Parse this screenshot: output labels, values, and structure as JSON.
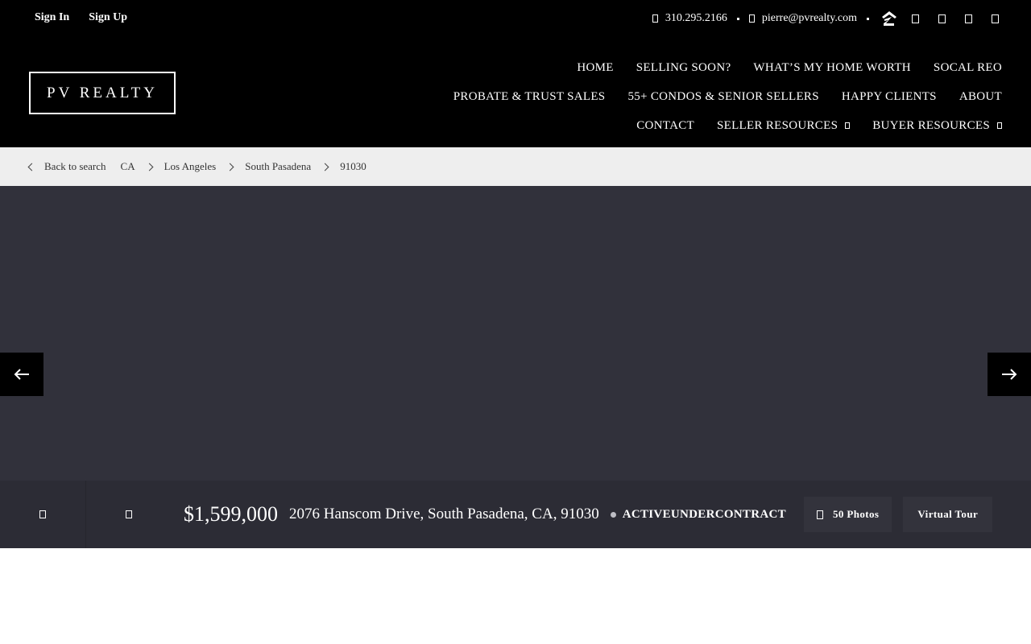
{
  "auth": {
    "sign_in": "Sign In",
    "sign_up": "Sign Up"
  },
  "contact": {
    "phone": "310.295.2166",
    "phone_icon": "phone-icon",
    "email": "pierre@pvrealty.com",
    "email_icon": "envelope-icon",
    "social_icons": [
      "zillow-icon",
      "facebook-icon",
      "instagram-icon",
      "linkedin-icon",
      "youtube-icon"
    ]
  },
  "logo": {
    "text": "PV REALTY"
  },
  "nav": {
    "row1": [
      "HOME",
      "SELLING SOON?",
      "WHAT’S MY HOME WORTH",
      "SOCAL REO"
    ],
    "row2": [
      "PROBATE & TRUST SALES",
      "55+ CONDOS & SENIOR SELLERS",
      "HAPPY CLIENTS",
      "ABOUT"
    ],
    "row3": [
      "CONTACT",
      "SELLER RESOURCES",
      "BUYER RESOURCES"
    ]
  },
  "breadcrumb": {
    "back": "Back to search",
    "items": [
      "CA",
      "Los Angeles",
      "South Pasadena",
      "91030"
    ]
  },
  "listing": {
    "price": "$1,599,000",
    "address": "2076 Hanscom Drive, South Pasadena, CA, 91030",
    "status": "ACTIVEUNDERCONTRACT",
    "photos_label": "50 Photos",
    "virtual_tour_label": "Virtual Tour",
    "left_buttons": [
      "favorite-icon",
      "share-icon"
    ]
  },
  "colors": {
    "header_bg": "#000000",
    "breadcrumb_bg": "#eeeeee",
    "gallery_bg": "#31313b",
    "info_bar_bg": "#2c2c35"
  }
}
